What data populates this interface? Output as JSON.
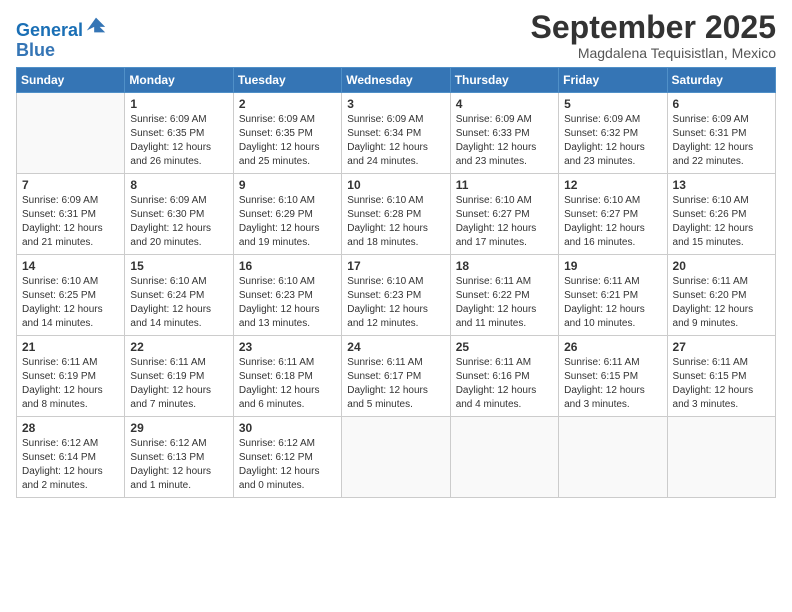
{
  "logo": {
    "line1": "General",
    "line2": "Blue"
  },
  "title": "September 2025",
  "subtitle": "Magdalena Tequisistlan, Mexico",
  "days_of_week": [
    "Sunday",
    "Monday",
    "Tuesday",
    "Wednesday",
    "Thursday",
    "Friday",
    "Saturday"
  ],
  "weeks": [
    [
      {
        "day": "",
        "info": ""
      },
      {
        "day": "1",
        "info": "Sunrise: 6:09 AM\nSunset: 6:35 PM\nDaylight: 12 hours\nand 26 minutes."
      },
      {
        "day": "2",
        "info": "Sunrise: 6:09 AM\nSunset: 6:35 PM\nDaylight: 12 hours\nand 25 minutes."
      },
      {
        "day": "3",
        "info": "Sunrise: 6:09 AM\nSunset: 6:34 PM\nDaylight: 12 hours\nand 24 minutes."
      },
      {
        "day": "4",
        "info": "Sunrise: 6:09 AM\nSunset: 6:33 PM\nDaylight: 12 hours\nand 23 minutes."
      },
      {
        "day": "5",
        "info": "Sunrise: 6:09 AM\nSunset: 6:32 PM\nDaylight: 12 hours\nand 23 minutes."
      },
      {
        "day": "6",
        "info": "Sunrise: 6:09 AM\nSunset: 6:31 PM\nDaylight: 12 hours\nand 22 minutes."
      }
    ],
    [
      {
        "day": "7",
        "info": "Sunrise: 6:09 AM\nSunset: 6:31 PM\nDaylight: 12 hours\nand 21 minutes."
      },
      {
        "day": "8",
        "info": "Sunrise: 6:09 AM\nSunset: 6:30 PM\nDaylight: 12 hours\nand 20 minutes."
      },
      {
        "day": "9",
        "info": "Sunrise: 6:10 AM\nSunset: 6:29 PM\nDaylight: 12 hours\nand 19 minutes."
      },
      {
        "day": "10",
        "info": "Sunrise: 6:10 AM\nSunset: 6:28 PM\nDaylight: 12 hours\nand 18 minutes."
      },
      {
        "day": "11",
        "info": "Sunrise: 6:10 AM\nSunset: 6:27 PM\nDaylight: 12 hours\nand 17 minutes."
      },
      {
        "day": "12",
        "info": "Sunrise: 6:10 AM\nSunset: 6:27 PM\nDaylight: 12 hours\nand 16 minutes."
      },
      {
        "day": "13",
        "info": "Sunrise: 6:10 AM\nSunset: 6:26 PM\nDaylight: 12 hours\nand 15 minutes."
      }
    ],
    [
      {
        "day": "14",
        "info": "Sunrise: 6:10 AM\nSunset: 6:25 PM\nDaylight: 12 hours\nand 14 minutes."
      },
      {
        "day": "15",
        "info": "Sunrise: 6:10 AM\nSunset: 6:24 PM\nDaylight: 12 hours\nand 14 minutes."
      },
      {
        "day": "16",
        "info": "Sunrise: 6:10 AM\nSunset: 6:23 PM\nDaylight: 12 hours\nand 13 minutes."
      },
      {
        "day": "17",
        "info": "Sunrise: 6:10 AM\nSunset: 6:23 PM\nDaylight: 12 hours\nand 12 minutes."
      },
      {
        "day": "18",
        "info": "Sunrise: 6:11 AM\nSunset: 6:22 PM\nDaylight: 12 hours\nand 11 minutes."
      },
      {
        "day": "19",
        "info": "Sunrise: 6:11 AM\nSunset: 6:21 PM\nDaylight: 12 hours\nand 10 minutes."
      },
      {
        "day": "20",
        "info": "Sunrise: 6:11 AM\nSunset: 6:20 PM\nDaylight: 12 hours\nand 9 minutes."
      }
    ],
    [
      {
        "day": "21",
        "info": "Sunrise: 6:11 AM\nSunset: 6:19 PM\nDaylight: 12 hours\nand 8 minutes."
      },
      {
        "day": "22",
        "info": "Sunrise: 6:11 AM\nSunset: 6:19 PM\nDaylight: 12 hours\nand 7 minutes."
      },
      {
        "day": "23",
        "info": "Sunrise: 6:11 AM\nSunset: 6:18 PM\nDaylight: 12 hours\nand 6 minutes."
      },
      {
        "day": "24",
        "info": "Sunrise: 6:11 AM\nSunset: 6:17 PM\nDaylight: 12 hours\nand 5 minutes."
      },
      {
        "day": "25",
        "info": "Sunrise: 6:11 AM\nSunset: 6:16 PM\nDaylight: 12 hours\nand 4 minutes."
      },
      {
        "day": "26",
        "info": "Sunrise: 6:11 AM\nSunset: 6:15 PM\nDaylight: 12 hours\nand 3 minutes."
      },
      {
        "day": "27",
        "info": "Sunrise: 6:11 AM\nSunset: 6:15 PM\nDaylight: 12 hours\nand 3 minutes."
      }
    ],
    [
      {
        "day": "28",
        "info": "Sunrise: 6:12 AM\nSunset: 6:14 PM\nDaylight: 12 hours\nand 2 minutes."
      },
      {
        "day": "29",
        "info": "Sunrise: 6:12 AM\nSunset: 6:13 PM\nDaylight: 12 hours\nand 1 minute."
      },
      {
        "day": "30",
        "info": "Sunrise: 6:12 AM\nSunset: 6:12 PM\nDaylight: 12 hours\nand 0 minutes."
      },
      {
        "day": "",
        "info": ""
      },
      {
        "day": "",
        "info": ""
      },
      {
        "day": "",
        "info": ""
      },
      {
        "day": "",
        "info": ""
      }
    ]
  ]
}
